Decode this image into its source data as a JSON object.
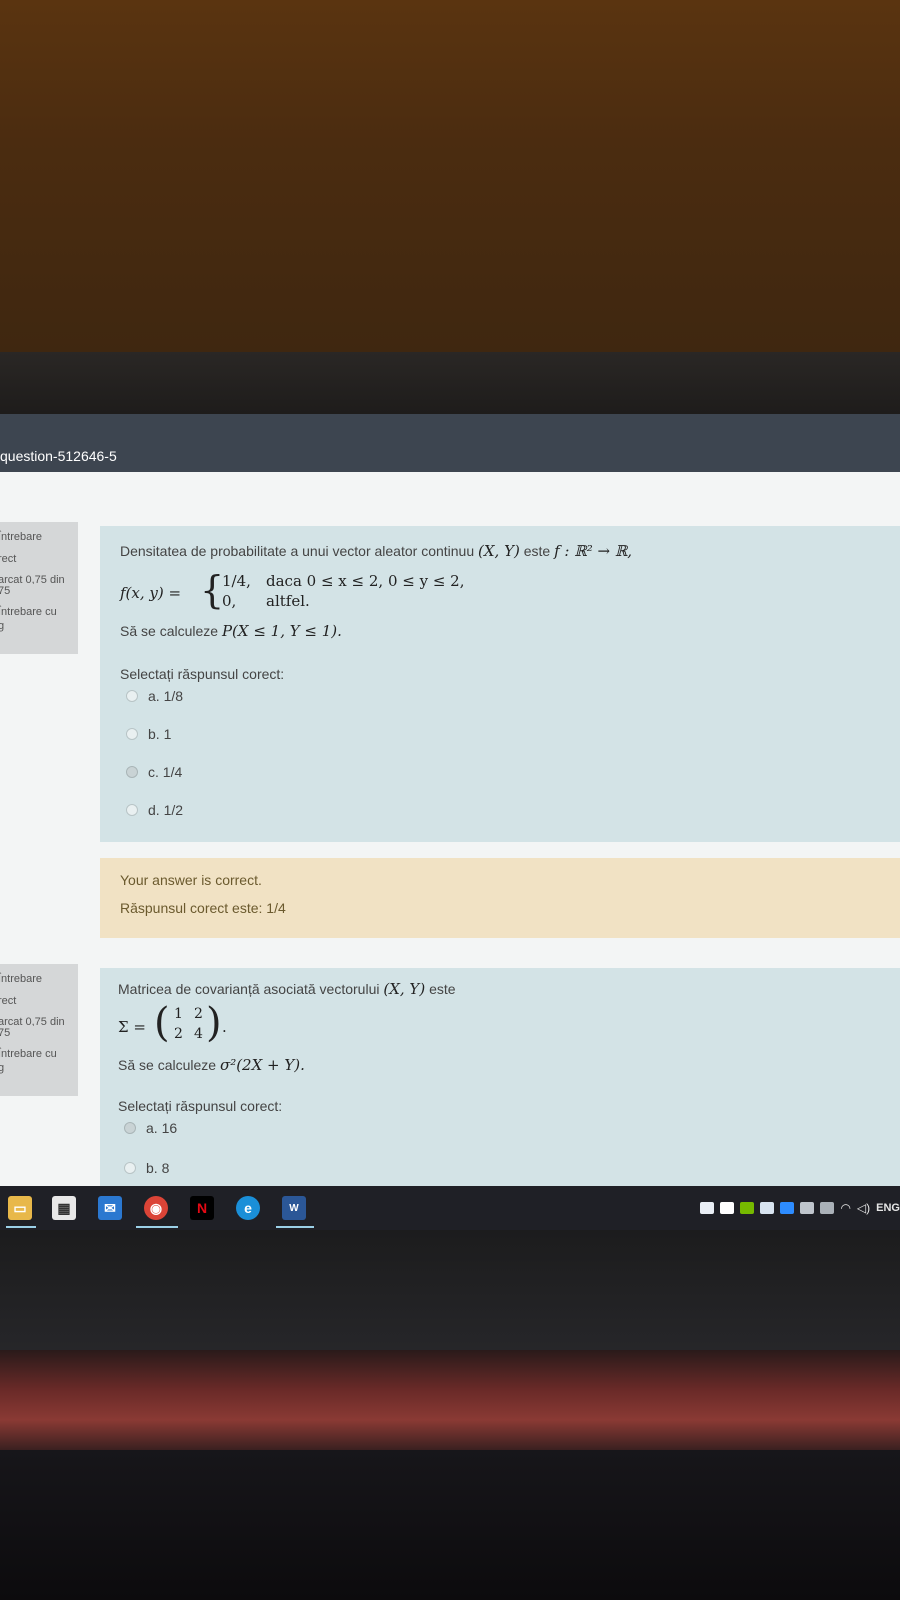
{
  "browser": {
    "url_fragment": "question-512646-5"
  },
  "questions": [
    {
      "info": {
        "label": "Întrebare",
        "status": "rect",
        "mark": "arcat 0,75 din",
        "mark_of": "75",
        "flag": "Întrebare cu",
        "flag2": "g"
      },
      "intro": "Densitatea de probabilitate a unui vector aleator continuu",
      "intro_math": "(X, Y)",
      "intro_mid": "este",
      "intro_math2": "f : ℝ² → ℝ,",
      "formula_lhs": "f(x, y) =",
      "case1_value": "1/4,",
      "case1_cond": "daca 0 ≤ x ≤ 2, 0 ≤ y ≤ 2,",
      "case2_value": "0,",
      "case2_cond": "altfel.",
      "ask": "Să se calculeze",
      "ask_math": "P(X ≤ 1, Y ≤ 1).",
      "prompt": "Selectați răspunsul corect:",
      "options": [
        {
          "label": "a. 1/8",
          "selected": false
        },
        {
          "label": "b. 1",
          "selected": false
        },
        {
          "label": "c. 1/4",
          "selected": true
        },
        {
          "label": "d. 1/2",
          "selected": false
        }
      ],
      "feedback": {
        "result": "Your answer is correct.",
        "correct_answer": "Răspunsul corect este: 1/4"
      }
    },
    {
      "info": {
        "label": "Întrebare",
        "status": "rect",
        "mark": "arcat 0,75 din",
        "mark_of": "75",
        "flag": "Întrebare cu",
        "flag2": "g"
      },
      "intro": "Matricea de covarianță asociată vectorului",
      "intro_math": "(X, Y)",
      "intro_mid": "este",
      "sigma_lhs": "Σ =",
      "matrix": [
        [
          "1",
          "2"
        ],
        [
          "2",
          "4"
        ]
      ],
      "ask": "Să se calculeze",
      "ask_math": "σ²(2X + Y).",
      "prompt": "Selectați răspunsul corect:",
      "options": [
        {
          "label": "a. 16",
          "selected": true
        },
        {
          "label": "b. 8",
          "selected": false
        }
      ]
    }
  ],
  "taskbar": {
    "apps": [
      "file-explorer",
      "store",
      "mail",
      "chrome",
      "netflix",
      "edge",
      "word"
    ],
    "tray_lang": "ENG"
  },
  "colors": {
    "question_bg": "#d3e3e6",
    "feedback_bg": "#f1e2c4",
    "info_bg": "#d5d7d8",
    "urlbar_bg": "#3d4550",
    "taskbar_bg": "#1f2026"
  }
}
